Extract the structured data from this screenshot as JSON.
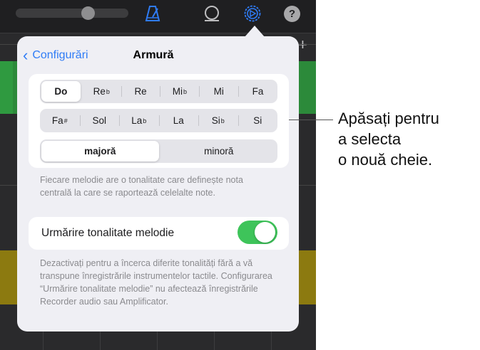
{
  "toolbar": {
    "volume_level": 0.66,
    "icons": [
      "metronome-icon",
      "loop-icon",
      "settings-icon",
      "help-icon"
    ],
    "help_glyph": "?",
    "add_glyph": "+",
    "accent": "#2f7cf6"
  },
  "popover": {
    "back_label": "Configurări",
    "title": "Armură",
    "keys_row1": [
      {
        "root": "Do",
        "acc": ""
      },
      {
        "root": "Re",
        "acc": "b"
      },
      {
        "root": "Re",
        "acc": ""
      },
      {
        "root": "Mi",
        "acc": "b"
      },
      {
        "root": "Mi",
        "acc": ""
      },
      {
        "root": "Fa",
        "acc": ""
      }
    ],
    "keys_row2": [
      {
        "root": "Fa",
        "acc": "#"
      },
      {
        "root": "Sol",
        "acc": ""
      },
      {
        "root": "La",
        "acc": "b"
      },
      {
        "root": "La",
        "acc": ""
      },
      {
        "root": "Si",
        "acc": "b"
      },
      {
        "root": "Si",
        "acc": ""
      }
    ],
    "selected_key": "Do",
    "modes": [
      "majoră",
      "minoră"
    ],
    "selected_mode": "majoră",
    "key_footer": "Fiecare melodie are o tonalitate care definește nota centrală la care se raportează celelalte note.",
    "follow_label": "Urmărire tonalitate melodie",
    "follow_enabled": true,
    "follow_footer": "Dezactivați pentru a încerca diferite tonalități fără a vă transpune înregistrările instrumentelor tactile. Configurarea “Urmărire tonalitate melodie” nu afectează înregistrările Recorder audio sau Amplificator."
  },
  "callout": {
    "lines": [
      "Apăsați pentru",
      "a selecta",
      "o nouă cheie."
    ]
  },
  "colors": {
    "toggle_on": "#3ec45a",
    "track_green": "#2c8a3a",
    "track_yellow": "#8c7a10"
  }
}
